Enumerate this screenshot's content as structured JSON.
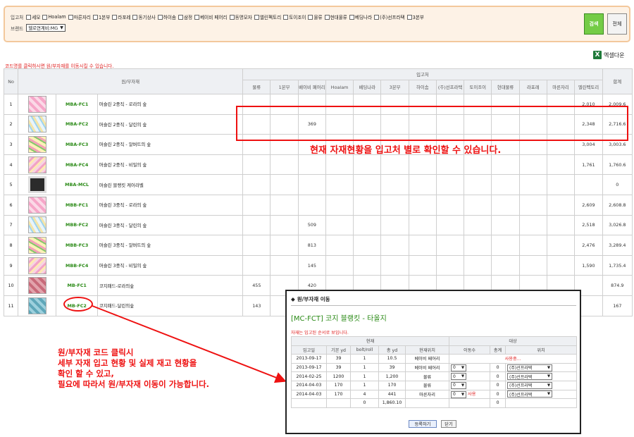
{
  "filter": {
    "supplier_label": "입고처",
    "suppliers": [
      "세모",
      "Hoalam",
      "마른자리",
      "1본부",
      "라포레",
      "동기상사",
      "하이솜",
      "삼정",
      "베이비 페어리",
      "동명모자",
      "엘린펙토리",
      "토이조이",
      "물류",
      "현대물류",
      "베딩나라",
      "(주)선프라택",
      "3본부"
    ],
    "brand_label": "브랜드",
    "brand_value": "헬로연계비:MG",
    "search_label": "검색",
    "all_label": "전체"
  },
  "excel_label": "엑셀다운",
  "notice": "코드명를 클릭하시면 원/부자재를 이동시킬 수 있습니다.",
  "table": {
    "col_no": "No",
    "col_material": "원/부자재",
    "col_supplier_group": "입고처",
    "col_total": "합계",
    "suppliers": [
      "물류",
      "1본부",
      "베이비 페어리",
      "Hoalam",
      "베딩나라",
      "3본부",
      "하이솜",
      "(주)선프라택",
      "토이조이",
      "현대물류",
      "라포레",
      "마른자리",
      "엘린펙토리"
    ],
    "rows": [
      {
        "no": "1",
        "code": "MBA-FC1",
        "name": "머슬린 2중직 - 로라의 숲",
        "thumb": "pink",
        "vals": [
          "",
          "",
          "",
          "",
          "",
          "",
          "",
          "",
          "",
          "",
          "",
          "",
          "2,010"
        ],
        "total": "2,009.6"
      },
      {
        "no": "2",
        "code": "MBA-FC2",
        "name": "머슬린 2중직 - 달린의 숲",
        "thumb": "white",
        "vals": [
          "",
          "",
          "369",
          "",
          "",
          "",
          "",
          "",
          "",
          "",
          "",
          "",
          "2,348"
        ],
        "total": "2,716.6"
      },
      {
        "no": "3",
        "code": "MBA-FC3",
        "name": "머슬린 2중직 - 알버트의 숲",
        "thumb": "yellow",
        "vals": [
          "",
          "",
          "",
          "",
          "",
          "",
          "",
          "",
          "",
          "",
          "",
          "",
          "3,004"
        ],
        "total": "3,003.6"
      },
      {
        "no": "4",
        "code": "MBA-FC4",
        "name": "머슬린 2중직 - 비밀의 숲",
        "thumb": "pink2",
        "vals": [
          "",
          "",
          "",
          "",
          "",
          "",
          "",
          "",
          "",
          "",
          "",
          "",
          "1,761"
        ],
        "total": "1,760.6"
      },
      {
        "no": "5",
        "code": "MBA-MCL",
        "name": "머슬린 블랭킷 케어라벨",
        "thumb": "label",
        "vals": [
          "",
          "",
          "",
          "",
          "",
          "",
          "",
          "",
          "",
          "",
          "",
          "",
          ""
        ],
        "total": "0"
      },
      {
        "no": "6",
        "code": "MBB-FC1",
        "name": "머슬린 3중직 - 로라의 숲",
        "thumb": "pink",
        "vals": [
          "",
          "",
          "",
          "",
          "",
          "",
          "",
          "",
          "",
          "",
          "",
          "",
          "2,609"
        ],
        "total": "2,608.8"
      },
      {
        "no": "7",
        "code": "MBB-FC2",
        "name": "머슬린 3중직 - 달린의 숲",
        "thumb": "white",
        "vals": [
          "",
          "",
          "509",
          "",
          "",
          "",
          "",
          "",
          "",
          "",
          "",
          "",
          "2,518"
        ],
        "total": "3,026.8"
      },
      {
        "no": "8",
        "code": "MBB-FC3",
        "name": "머슬린 3중직 - 알버트의 숲",
        "thumb": "yellow",
        "vals": [
          "",
          "",
          "813",
          "",
          "",
          "",
          "",
          "",
          "",
          "",
          "",
          "",
          "2,476"
        ],
        "total": "3,289.4"
      },
      {
        "no": "9",
        "code": "MBB-FC4",
        "name": "머슬린 3중직 - 비밀의 숲",
        "thumb": "pink2",
        "vals": [
          "",
          "",
          "145",
          "",
          "",
          "",
          "",
          "",
          "",
          "",
          "",
          "",
          "1,590"
        ],
        "total": "1,735.4"
      },
      {
        "no": "10",
        "code": "MB-FC1",
        "name": "코지패드-로라의숲",
        "thumb": "pink3",
        "vals": [
          "455",
          "",
          "420",
          "",
          "",
          "",
          "",
          "",
          "",
          "",
          "",
          "",
          ""
        ],
        "total": "874.9"
      },
      {
        "no": "11",
        "code": "MB-FC2",
        "name": "코지패드-달린의숲",
        "thumb": "teal",
        "vals": [
          "143",
          "",
          "",
          "",
          "",
          "",
          "",
          "",
          "",
          "",
          "",
          "",
          ""
        ],
        "total": "167"
      }
    ]
  },
  "annotation_top": "현재 자재현황을 입고처 별로 확인할 수 있습니다.",
  "annotation_left": [
    "원/부자재 코드 클릭시",
    "세부 자재 입고 현황 및 실제 재고 현황을",
    "확인 할 수 있고,",
    "필요에 따라서 원/부자재 이동이 가능합니다."
  ],
  "popup": {
    "title": "원/부자재 이동",
    "product": "[MC-FCT] 코지 블랭킷 - 타올지",
    "note": "자재는 입고된 순서로 보입니다.",
    "group_current": "현재",
    "group_target": "대상",
    "headers": [
      "입고일",
      "기본 yd",
      "bolt/roll",
      "총 yd",
      "현재위치",
      "이동수",
      "총계",
      "위치"
    ],
    "rows": [
      {
        "date": "2013-09-17",
        "base": "39",
        "bolt": "1",
        "total": "10.5",
        "loc": "베이비 페어리",
        "mode": "using",
        "using_text": "사용중..."
      },
      {
        "date": "2013-09-17",
        "base": "39",
        "bolt": "1",
        "total": "39",
        "loc": "베이비 페어리",
        "mode": "move",
        "qty": "0",
        "sum": "0",
        "target": "(주)선프라택"
      },
      {
        "date": "2014-02-25",
        "base": "1200",
        "bolt": "1",
        "total": "1,200",
        "loc": "물류",
        "mode": "move",
        "qty": "0",
        "sum": "0",
        "target": "(주)선프라택"
      },
      {
        "date": "2014-04-03",
        "base": "170",
        "bolt": "1",
        "total": "170",
        "loc": "물류",
        "mode": "move",
        "qty": "0",
        "sum": "0",
        "target": "(주)선프라택"
      },
      {
        "date": "2014-04-03",
        "base": "170",
        "bolt": "4",
        "total": "441",
        "loc": "마른자리",
        "mode": "move2",
        "qty": "0",
        "flag": "사용",
        "sum": "0",
        "target": "(주)선프라택"
      }
    ],
    "footer_bolt": "0",
    "footer_total": "1,860.10",
    "footer_sum": "0",
    "register_label": "등록하기",
    "close_label": "닫기"
  },
  "colors": {
    "code_green": "#2a8a16",
    "annotation_red": "#e11111",
    "search_green": "#74cc46"
  }
}
